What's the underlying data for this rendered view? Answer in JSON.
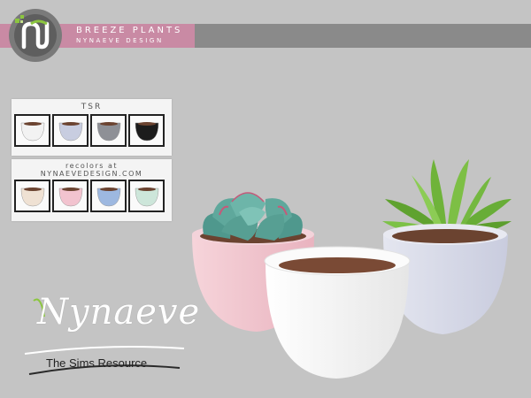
{
  "header": {
    "title": "BREEZE PLANTS",
    "subtitle": "NYNAEVE DESIGN",
    "bar_pink": "#c98aa4",
    "bar_grey": "#8a8a8a"
  },
  "swatches_tsr": {
    "title": "TSR",
    "items": [
      {
        "name": "white",
        "color": "#f2f2f2"
      },
      {
        "name": "light-blue",
        "color": "#c8cde0"
      },
      {
        "name": "grey",
        "color": "#8e9096"
      },
      {
        "name": "black",
        "color": "#1c1c1c"
      }
    ]
  },
  "swatches_recolor": {
    "title_line1": "recolors at",
    "title_line2": "NYNAEVEDESIGN.COM",
    "items": [
      {
        "name": "cream",
        "color": "#efe1d3"
      },
      {
        "name": "pink",
        "color": "#f2c3cf"
      },
      {
        "name": "blue",
        "color": "#9db8e0"
      },
      {
        "name": "mint",
        "color": "#cde6da"
      }
    ]
  },
  "branding": {
    "word": "Nynaeve",
    "tagline": "The Sims Resource"
  },
  "icons": {
    "logo": "nynaeve-logo-icon"
  },
  "colors": {
    "background": "#c4c4c4",
    "pot_pink": "#f2c6cf",
    "pot_white": "#f6f6f6",
    "pot_blue": "#d9dbe8",
    "soil": "#7a4a35",
    "succulent": "#5fa89c",
    "aloe": "#6fb33a"
  }
}
